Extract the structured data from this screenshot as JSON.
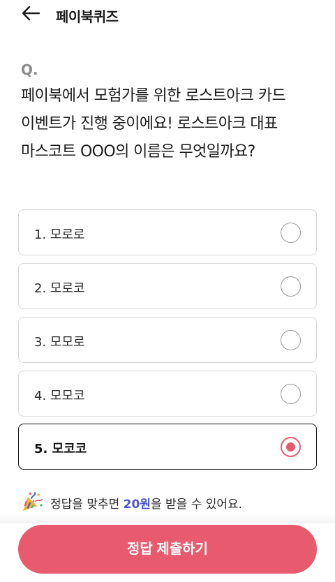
{
  "header": {
    "back_icon": "arrow-left-icon",
    "title": "페이북퀴즈"
  },
  "quiz": {
    "q_label": "Q.",
    "question": "페이북에서 모험가를 위한 로스트아크 카드 이벤트가 진행 중이에요! 로스트아크 대표 마스코트 OOO의 이름은 무엇일까요?",
    "options": [
      {
        "label": "1. 모로로",
        "selected": false
      },
      {
        "label": "2. 모로코",
        "selected": false
      },
      {
        "label": "3. 모모로",
        "selected": false
      },
      {
        "label": "4. 모모코",
        "selected": false
      },
      {
        "label": "5. 모코코",
        "selected": true
      }
    ]
  },
  "notice": {
    "icon": "party-popper-icon",
    "prefix": "정답을 맞추면 ",
    "amount": "20원",
    "suffix": "을 받을 수 있어요."
  },
  "submit_label": "정답 제출하기",
  "colors": {
    "accent": "#e85a6e",
    "highlight": "#4a56d6",
    "q_label": "#8b8b8b"
  }
}
